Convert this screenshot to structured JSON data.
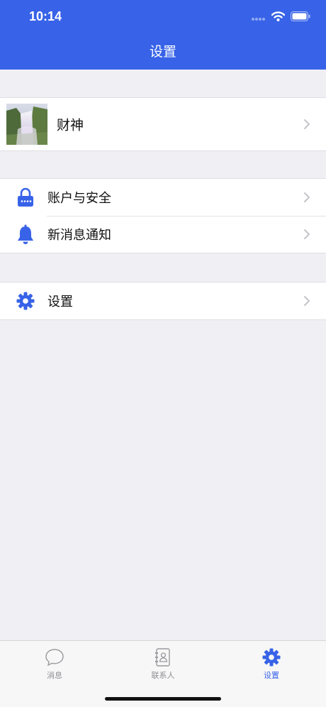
{
  "status": {
    "time": "10:14"
  },
  "nav": {
    "title": "设置"
  },
  "profile": {
    "name": "财神"
  },
  "menu": {
    "account_security": "账户与安全",
    "notifications": "新消息通知",
    "settings": "设置"
  },
  "tabs": [
    {
      "label": "消息",
      "icon": "chat-bubble-icon",
      "active": false
    },
    {
      "label": "联系人",
      "icon": "contacts-book-icon",
      "active": false
    },
    {
      "label": "设置",
      "icon": "gear-icon",
      "active": true
    }
  ],
  "colors": {
    "accent": "#3863e8",
    "background": "#efeff4",
    "tab_inactive": "#8e8e93"
  }
}
